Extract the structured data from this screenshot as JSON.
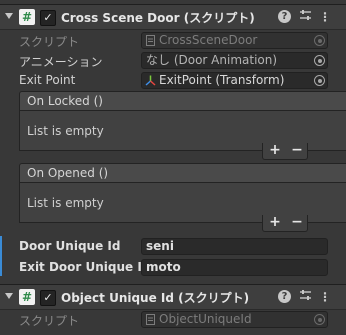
{
  "component1": {
    "title": "Cross Scene Door (スクリプト)",
    "rows": [
      {
        "label": "スクリプト",
        "value": "CrossSceneDoor"
      },
      {
        "label": "アニメーション",
        "value": "なし (Door Animation)"
      },
      {
        "label": "Exit Point",
        "value": "ExitPoint (Transform)"
      }
    ],
    "events": [
      {
        "header": "On Locked ()",
        "body": "List is empty"
      },
      {
        "header": "On Opened ()",
        "body": "List is empty"
      }
    ],
    "fields": [
      {
        "label": "Door Unique Id",
        "value": "seni"
      },
      {
        "label": "Exit Door Unique Id",
        "value": "moto"
      }
    ]
  },
  "component2": {
    "title": "Object Unique Id (スクリプト)",
    "rows": [
      {
        "label": "スクリプト",
        "value": "ObjectUniqueId"
      }
    ]
  },
  "buttons": {
    "add": "+",
    "remove": "−"
  },
  "colors": {
    "background": "#383838",
    "header": "#3e3e3e",
    "accent": "#3a8bd6",
    "script_icon": "#2f8a4a"
  }
}
